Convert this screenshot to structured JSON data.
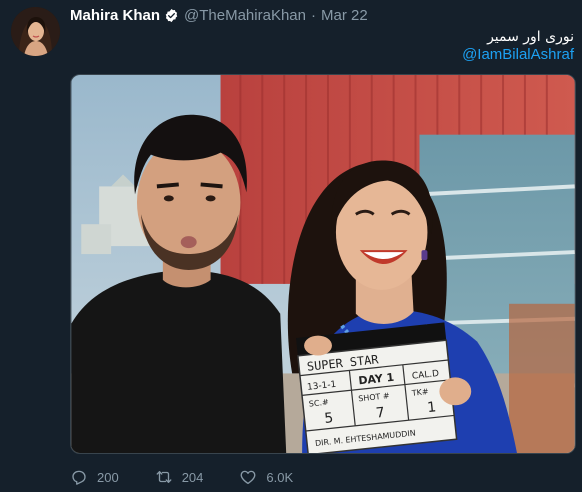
{
  "tweet": {
    "display_name": "Mahira Khan",
    "handle": "@TheMahiraKhan",
    "separator": "·",
    "date": "Mar 22",
    "text": "نوری اور سمیر",
    "mention": "@IamBilalAshraf",
    "verified": true
  },
  "media": {
    "clapperboard": {
      "title": "SUPER STAR",
      "row1_left": "13-1-1",
      "row1_mid": "DAY 1",
      "row1_right": "CAL.D",
      "scene_label": "SC.#",
      "scene_value": "5",
      "shot_label": "SHOT #",
      "shot_value": "7",
      "take_label": "TK#",
      "take_value": "1",
      "director": "DIR. M. EHTESHAMUDDIN"
    }
  },
  "actions": {
    "replies": "200",
    "retweets": "204",
    "likes": "6.0K"
  },
  "colors": {
    "background": "#15202b",
    "secondary_text": "#8899a6",
    "link": "#1da1f2",
    "verified": "#ffffff"
  }
}
